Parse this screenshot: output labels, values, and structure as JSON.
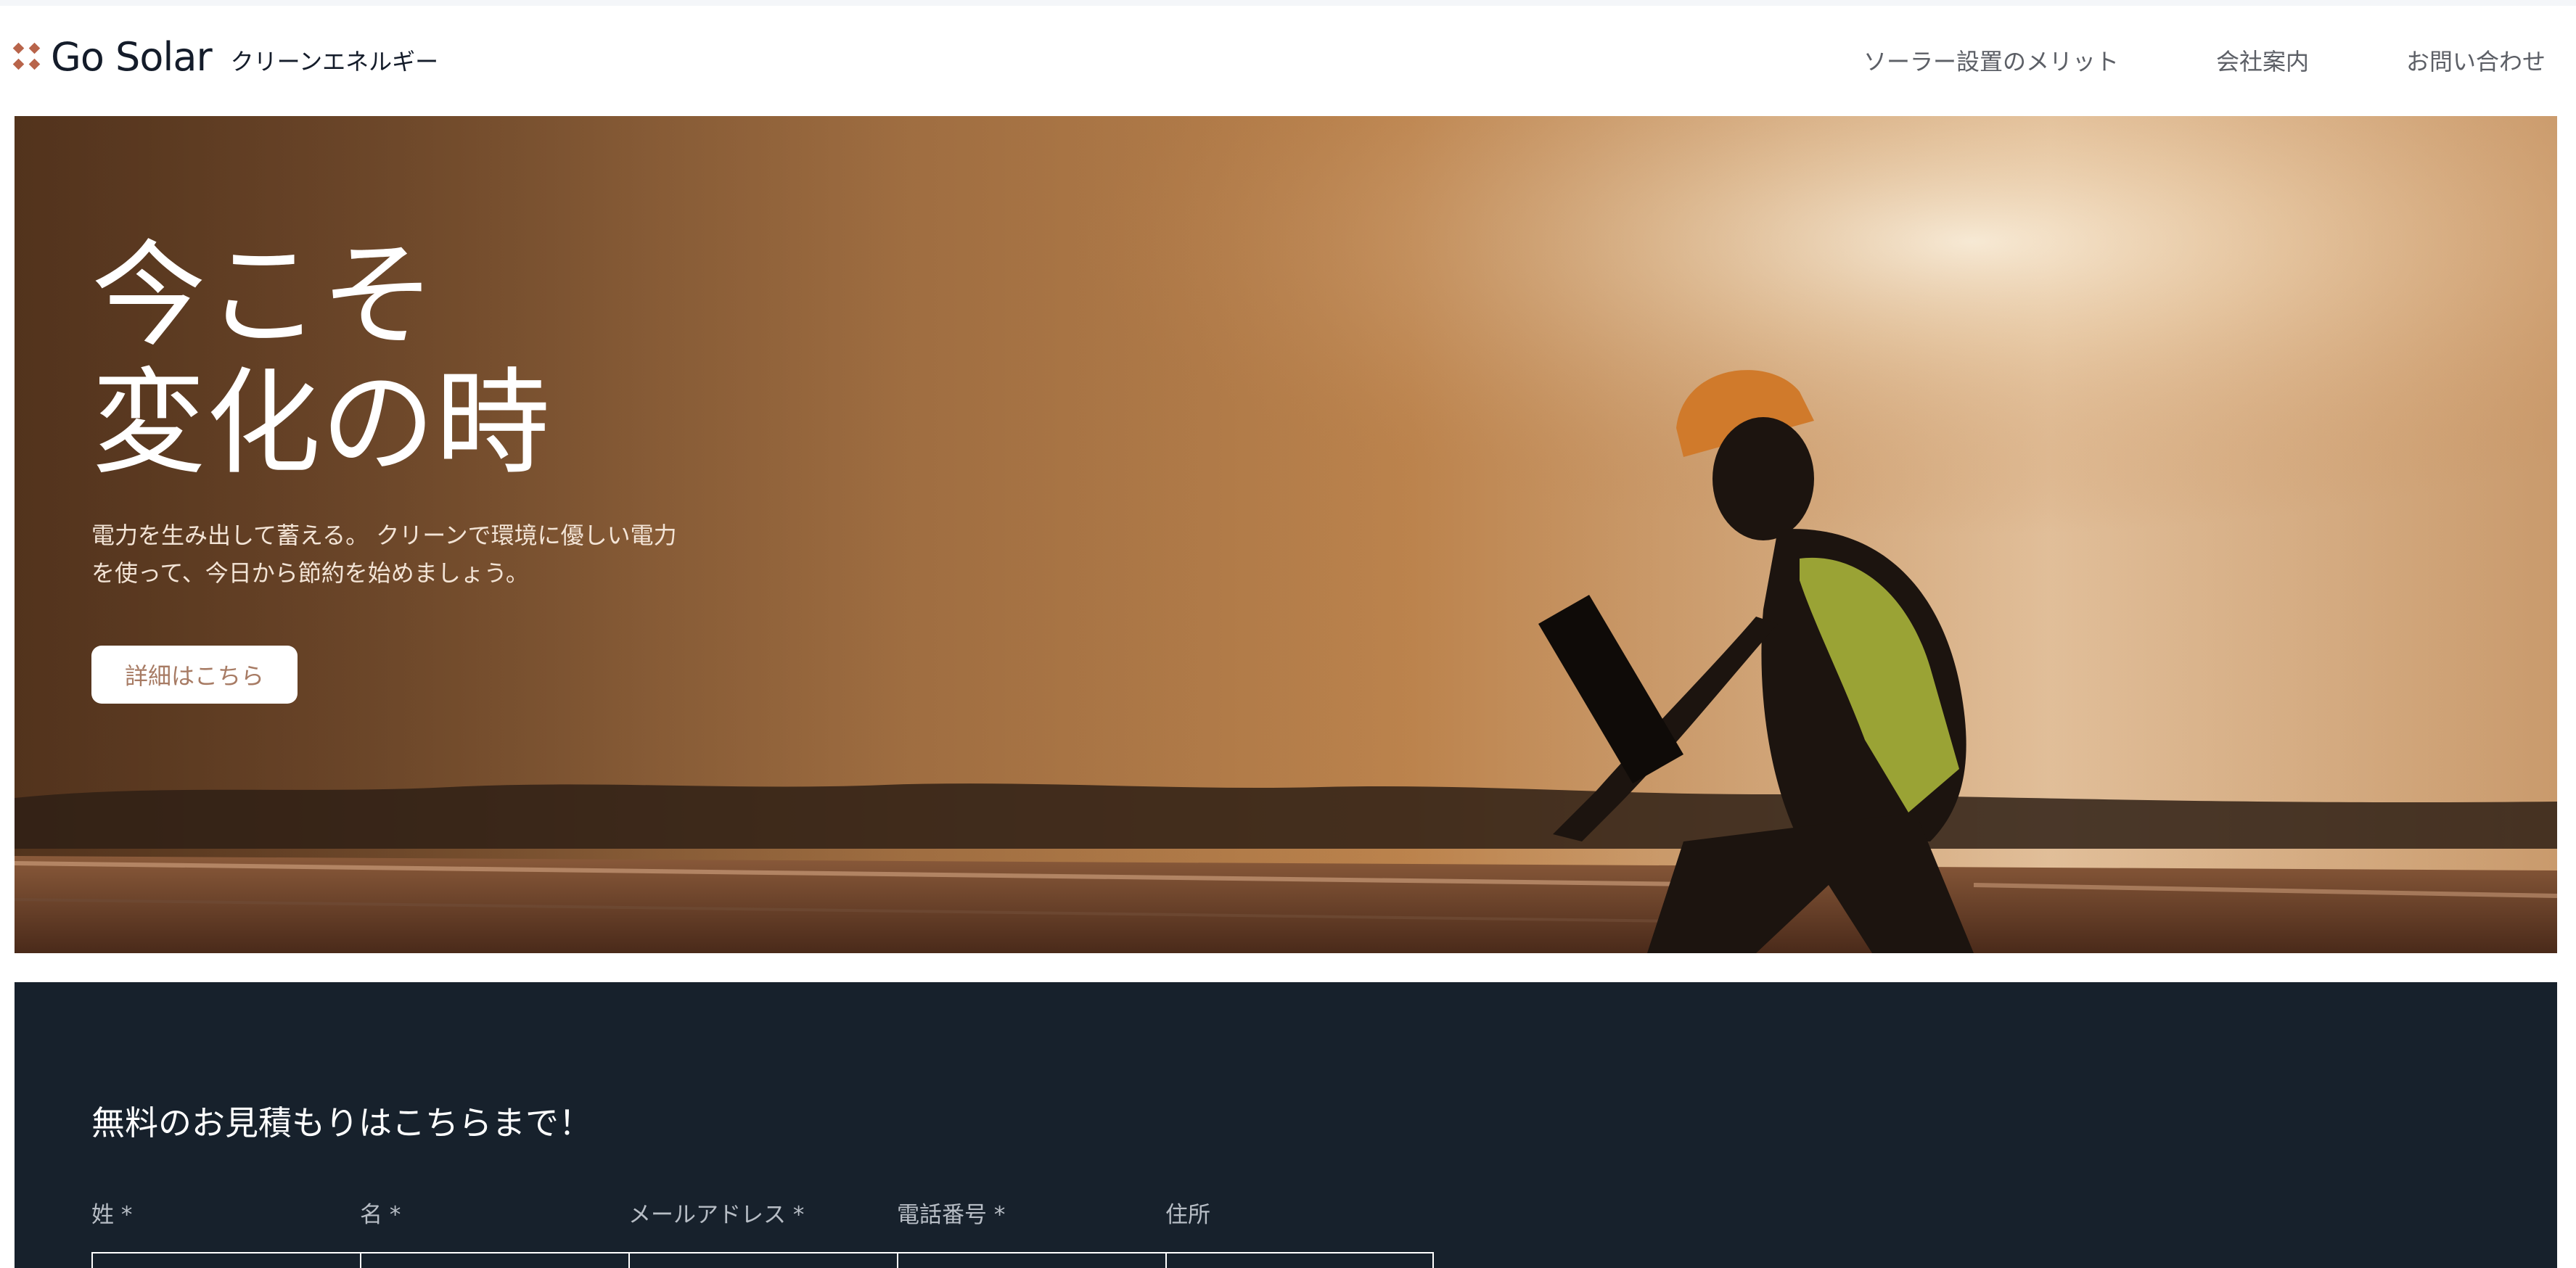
{
  "brand": {
    "name": "Go Solar",
    "tagline": "クリーンエネルギー"
  },
  "nav": {
    "items": [
      "ソーラー設置のメリット",
      "会社案内",
      "お問い合わせ"
    ]
  },
  "hero": {
    "title_line1": "今こそ",
    "title_line2": "変化の時",
    "subtitle_line1": "電力を生み出して蓄える。 クリーンで環境に優しい電力",
    "subtitle_line2": "を使って、今日から節約を始めましょう。",
    "cta_label": "詳細はこちら"
  },
  "quote": {
    "title": "無料のお見積もりはこちらまで！",
    "fields": [
      {
        "label": "姓 *"
      },
      {
        "label": "名 *"
      },
      {
        "label": "メールアドレス *"
      },
      {
        "label": "電話番号 *"
      },
      {
        "label": "住所"
      }
    ]
  },
  "colors": {
    "accent": "#b8644a",
    "dark_section": "#17212c",
    "cta_text": "#a77b64",
    "nav_text": "#5c5f66"
  }
}
